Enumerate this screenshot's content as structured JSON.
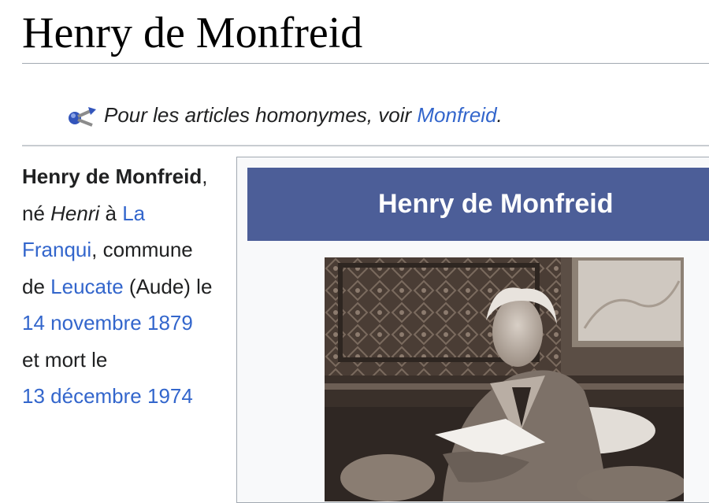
{
  "article": {
    "title": "Henry de Monfreid"
  },
  "hatnote": {
    "prefix": "Pour les articles homonymes, voir ",
    "link": "Monfreid",
    "suffix": ".",
    "icon": "disambiguation-icon"
  },
  "intro": {
    "name_bold": "Henry de Monfreid",
    "t1": ", né ",
    "birth_name": "Henri",
    "t2": " à ",
    "place_link": "La Franqui",
    "t3": ", commune de ",
    "commune_link": "Leucate",
    "t4": " (Aude) le ",
    "birth_date_link": "14 novembre 1879",
    "t5": " et mort le ",
    "death_date_link": "13 décembre 1974"
  },
  "infobox": {
    "header": "Henry de Monfreid",
    "photo": "portrait-photo"
  },
  "colors": {
    "link": "#3366cc",
    "infobox_header_bg": "#4c5e98",
    "rule": "#a2a9b1"
  }
}
